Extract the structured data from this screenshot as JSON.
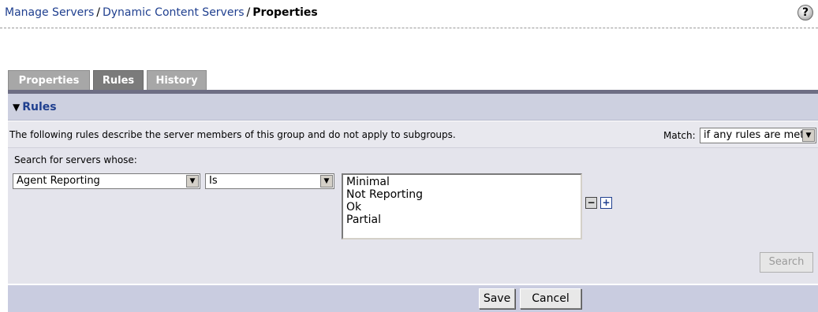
{
  "breadcrumb": {
    "items": [
      "Manage Servers",
      "Dynamic Content Servers"
    ],
    "separator": "/",
    "current": "Properties"
  },
  "help": {
    "icon": "help-icon",
    "glyph": "?"
  },
  "tabs": [
    {
      "label": "Properties",
      "active": false
    },
    {
      "label": "Rules",
      "active": true
    },
    {
      "label": "History",
      "active": false
    }
  ],
  "section": {
    "title": "Rules",
    "collapse_glyph": "▼"
  },
  "description": "The following rules describe the server members of this group and do not apply to subgroups.",
  "match": {
    "label": "Match:",
    "value": "if any rules are met"
  },
  "search": {
    "label": "Search for servers whose:",
    "field": "Agent Reporting",
    "operator": "Is",
    "values": [
      "Minimal",
      "Not Reporting",
      "Ok",
      "Partial"
    ],
    "button": "Search"
  },
  "rule_buttons": {
    "remove_glyph": "−",
    "add_glyph": "+"
  },
  "footer": {
    "save": "Save",
    "cancel": "Cancel"
  },
  "colors": {
    "link": "#1f3f8f",
    "tab_active": "#7b7b7b",
    "tab_inactive": "#a7a7a7",
    "section_bg": "#cdd0e0",
    "footer_bg": "#c9cce0"
  }
}
